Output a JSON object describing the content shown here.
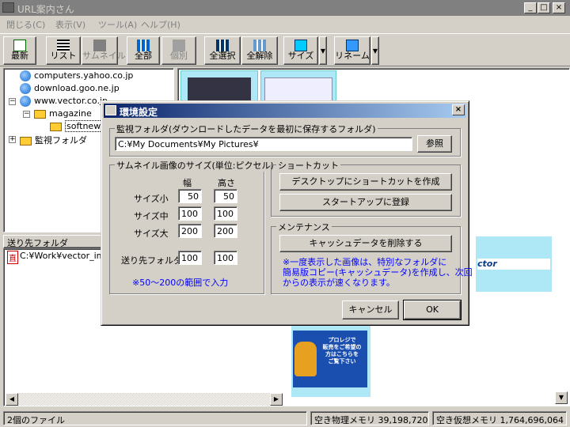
{
  "window": {
    "title": "URL案内さん"
  },
  "menu": [
    "閉じる(C)",
    "表示(V)",
    "ツール(A)",
    "ヘルプ(H)"
  ],
  "toolbar": {
    "refresh": "最新",
    "list": "リスト",
    "thumbnail": "サムネイル",
    "all": "全部",
    "individual": "個別",
    "select_all": "全選択",
    "deselect_all": "全解除",
    "size": "サイズ",
    "rename": "リネーム"
  },
  "tree": {
    "items": [
      "computers.yahoo.co.jp",
      "download.goo.ne.jp",
      "www.vector.co.jp",
      "magazine",
      "softnews",
      "監視フォルダ"
    ]
  },
  "dest": {
    "header": "送り先フォルダ",
    "badge": "直",
    "path": "C:¥Work¥vector_ima"
  },
  "thumbs": {
    "vector_text": "ctor",
    "ad_lines": [
      "プロレジで",
      "販売をご希望の",
      "方はこちらを",
      "ご覧下さい"
    ]
  },
  "status": {
    "files": "2個のファイル",
    "physical": "空き物理メモリ 39,198,720",
    "virtual": "空き仮想メモリ 1,764,696,064"
  },
  "dialog": {
    "title": "環境設定",
    "watch_group": "監視フォルダ(ダウンロードしたデータを最初に保存するフォルダ)",
    "watch_path": "C:¥My Documents¥My Pictures¥",
    "browse": "参照",
    "size_group": "サムネイル画像のサイズ(単位:ピクセル)",
    "col_width": "幅",
    "col_height": "高さ",
    "rows": [
      {
        "label": "サイズ小",
        "w": "50",
        "h": "50"
      },
      {
        "label": "サイズ中",
        "w": "100",
        "h": "100"
      },
      {
        "label": "サイズ大",
        "w": "200",
        "h": "200"
      },
      {
        "label": "送り先フォルダ",
        "w": "100",
        "h": "100"
      }
    ],
    "range_note": "※50〜200の範囲で入力",
    "shortcut_group": "ショートカット",
    "desktop_shortcut": "デスクトップにショートカットを作成",
    "startup_register": "スタートアップに登録",
    "maintenance_group": "メンテナンス",
    "clear_cache": "キャッシュデータを削除する",
    "cache_note": [
      "※一度表示した画像は、特別なフォルダに",
      "簡易版コピー(キャッシュデータ)を作成し、次回",
      "からの表示が速くなります。"
    ],
    "cancel": "キャンセル",
    "ok": "OK"
  }
}
